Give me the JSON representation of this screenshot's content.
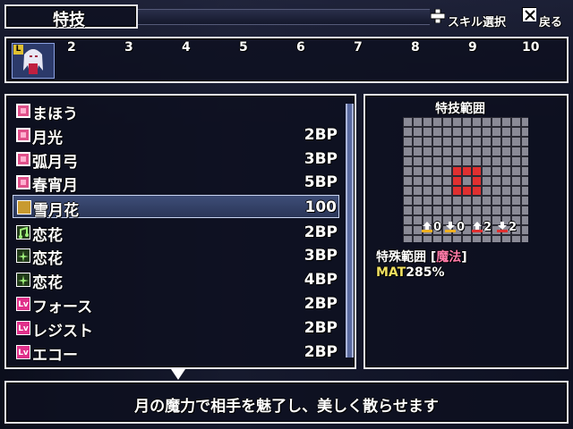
{
  "screen": {
    "title": "特技",
    "hints": {
      "skill_select": "スキル選択",
      "back": "戻る"
    }
  },
  "party": {
    "level_badge": "L",
    "slots": [
      "2",
      "3",
      "4",
      "5",
      "6",
      "7",
      "8",
      "9",
      "10"
    ]
  },
  "skills": [
    {
      "name": "まほう",
      "cost": "",
      "icon": "magic-category-icon"
    },
    {
      "name": "月光",
      "cost": "2BP",
      "icon": "pink-skill-icon"
    },
    {
      "name": "弧月弓",
      "cost": "3BP",
      "icon": "pink-skill-icon"
    },
    {
      "name": "春宵月",
      "cost": "5BP",
      "icon": "pink-skill-icon"
    },
    {
      "name": "雪月花",
      "cost": "100",
      "icon": "gold-skill-icon",
      "selected": true
    },
    {
      "name": "恋花",
      "cost": "2BP",
      "icon": "green-music-icon"
    },
    {
      "name": "恋花",
      "cost": "3BP",
      "icon": "green-sparkle-icon"
    },
    {
      "name": "恋花",
      "cost": "4BP",
      "icon": "green-sparkle-icon"
    },
    {
      "name": "フォース",
      "cost": "2BP",
      "icon": "lv-icon"
    },
    {
      "name": "レジスト",
      "cost": "2BP",
      "icon": "lv-icon"
    },
    {
      "name": "エコー",
      "cost": "2BP",
      "icon": "lv-icon"
    }
  ],
  "range": {
    "title": "特技範囲",
    "stats": [
      "0",
      "0",
      "2",
      "2"
    ],
    "special_label": "特殊範囲 [",
    "special_type": "魔法",
    "special_close": "]",
    "mat_label": "MAT",
    "mat_value": "285%",
    "colors": {
      "grid_bg": "#2a2a34",
      "cell": "#8a8a96",
      "target": "#e03030",
      "type_text": "#ff7aa8",
      "mat_text": "#f0e060"
    }
  },
  "description": "月の魔力で相手を魅了し、美しく散らせます"
}
